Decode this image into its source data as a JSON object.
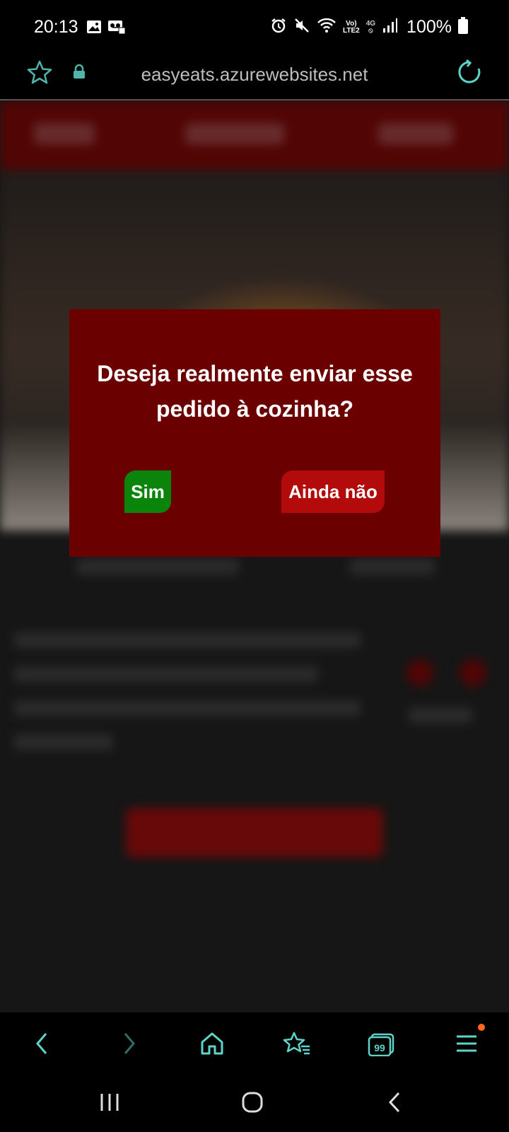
{
  "status_bar": {
    "time": "20:13",
    "signal_small_top": "Vo)",
    "signal_small_bottom": "LTE2",
    "net_type": "4G",
    "battery": "100%"
  },
  "address_bar": {
    "url": "easyeats.azurewebsites.net"
  },
  "dialog": {
    "message": "Deseja realmente enviar esse pedido à cozinha?",
    "confirm_label": "Sim",
    "cancel_label": "Ainda não",
    "confirm_color": "#0b840b",
    "cancel_color": "#b30b0b",
    "background_color": "#6a0000"
  },
  "toolbar": {
    "tabs_count": "99",
    "accent_color": "#5fd3c8"
  }
}
